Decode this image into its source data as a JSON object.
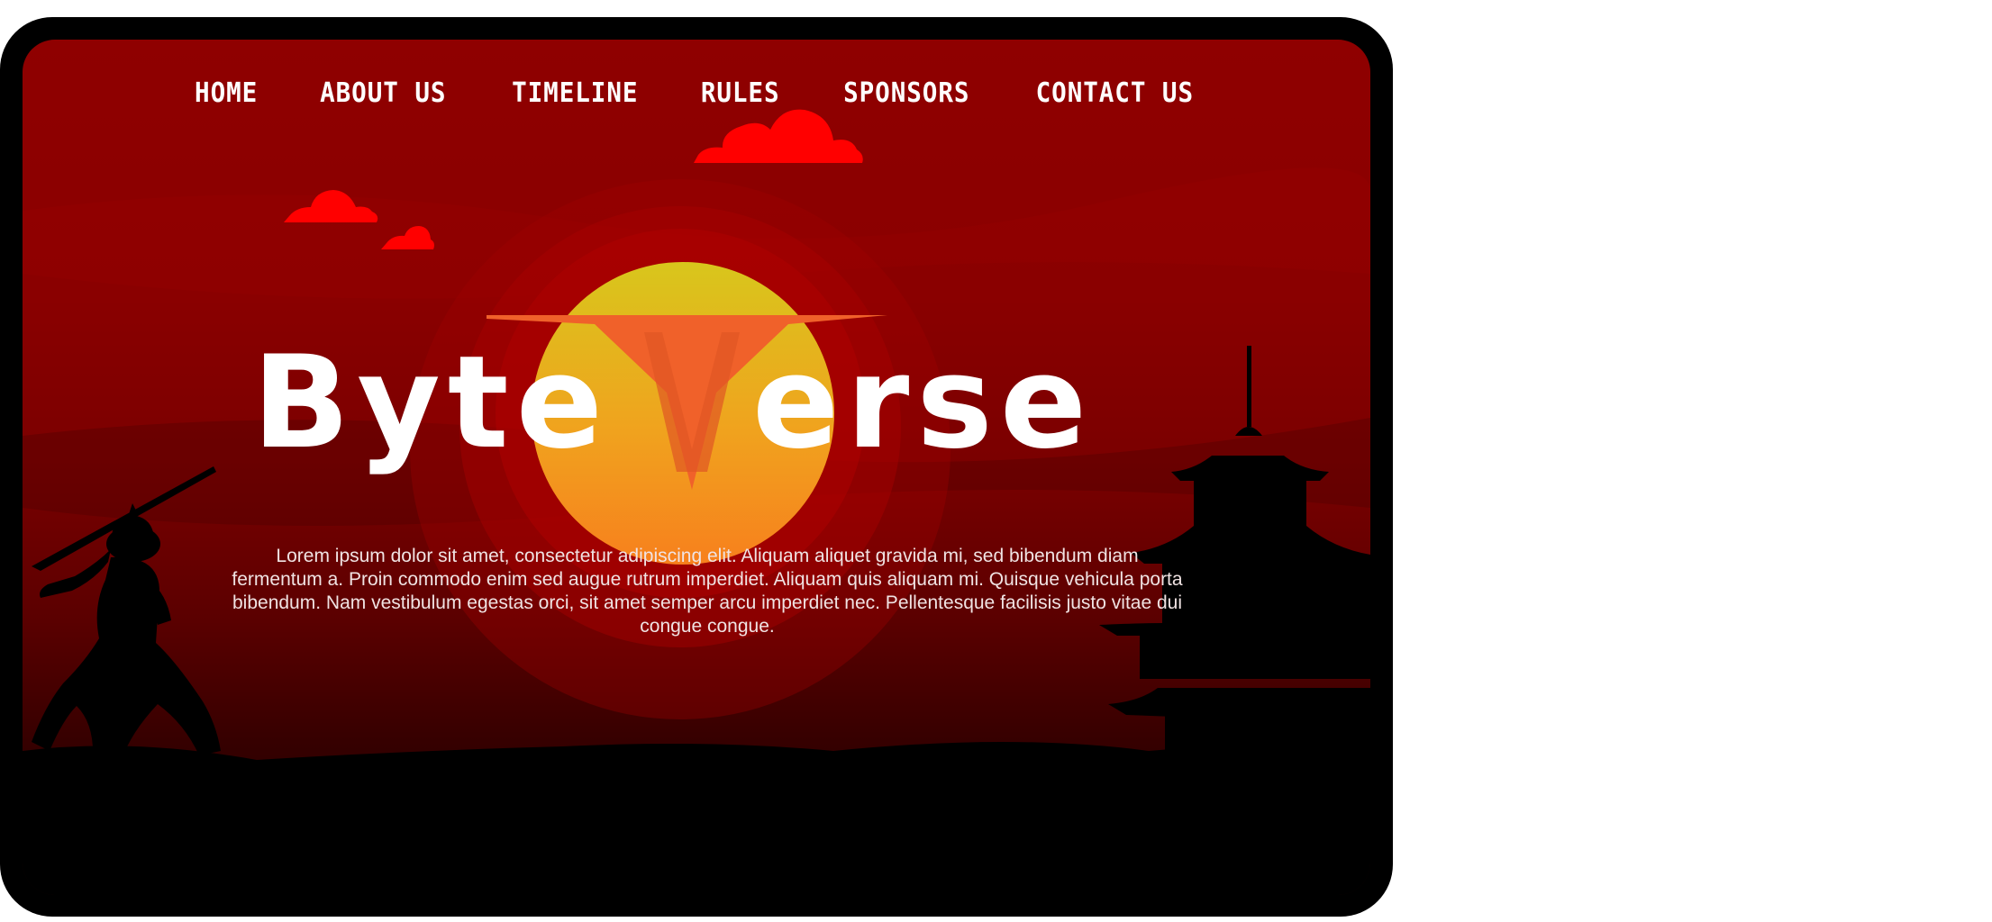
{
  "nav": {
    "items": [
      {
        "label": "HOME"
      },
      {
        "label": "ABOUT US"
      },
      {
        "label": "TIMELINE"
      },
      {
        "label": "RULES"
      },
      {
        "label": "SPONSORS"
      },
      {
        "label": "CONTACT US"
      }
    ]
  },
  "hero": {
    "title_part1": "Byte",
    "title_v": "V",
    "title_part2": "erse",
    "description": "Lorem ipsum dolor sit amet, consectetur adipiscing elit. Aliquam aliquet gravida mi, sed bibendum diam fermentum a. Proin commodo enim sed augue rutrum imperdiet. Aliquam quis aliquam mi. Quisque vehicula porta bibendum. Nam vestibulum egestas orci, sit amet semper arcu imperdiet nec. Pellentesque facilisis justo vitae dui congue congue."
  },
  "colors": {
    "background_top": "#8f0000",
    "background_bottom": "#1a0000",
    "sun_top": "#d8c61c",
    "sun_bottom": "#f58a1e",
    "accent_v": "#f0612a",
    "cloud": "#ff0000",
    "silhouette": "#000000",
    "text": "#ffffff"
  }
}
